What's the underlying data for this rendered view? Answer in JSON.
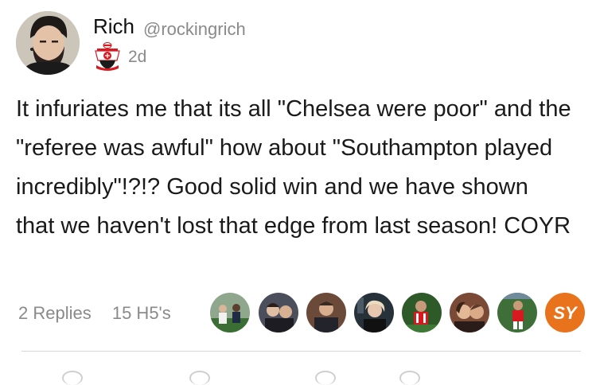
{
  "author": {
    "name": "Rich",
    "handle": "@rockingrich",
    "avatar_icon": "profile-photo-icon",
    "badge_icon": "southampton-crest-icon",
    "time": "2d"
  },
  "tweet": {
    "text": "It infuriates me that its all \"Chelsea were poor\" and the \"referee was awful\" how about \"Southampton played incredibly\"!?!? Good solid win and we have shown that we haven't lost that edge from last season! COYR"
  },
  "stats": {
    "replies": "2 Replies",
    "h5s": "15 H5's"
  },
  "likers": [
    {
      "icon": "liker-avatar-1"
    },
    {
      "icon": "liker-avatar-2"
    },
    {
      "icon": "liker-avatar-3"
    },
    {
      "icon": "liker-avatar-4"
    },
    {
      "icon": "liker-avatar-5"
    },
    {
      "icon": "liker-avatar-6"
    },
    {
      "icon": "liker-avatar-7"
    },
    {
      "icon": "sy-logo-icon",
      "label": "SY"
    }
  ],
  "colors": {
    "accent_orange": "#e8731c",
    "text_gray": "#8a8a8a",
    "southampton_red": "#d71920"
  }
}
